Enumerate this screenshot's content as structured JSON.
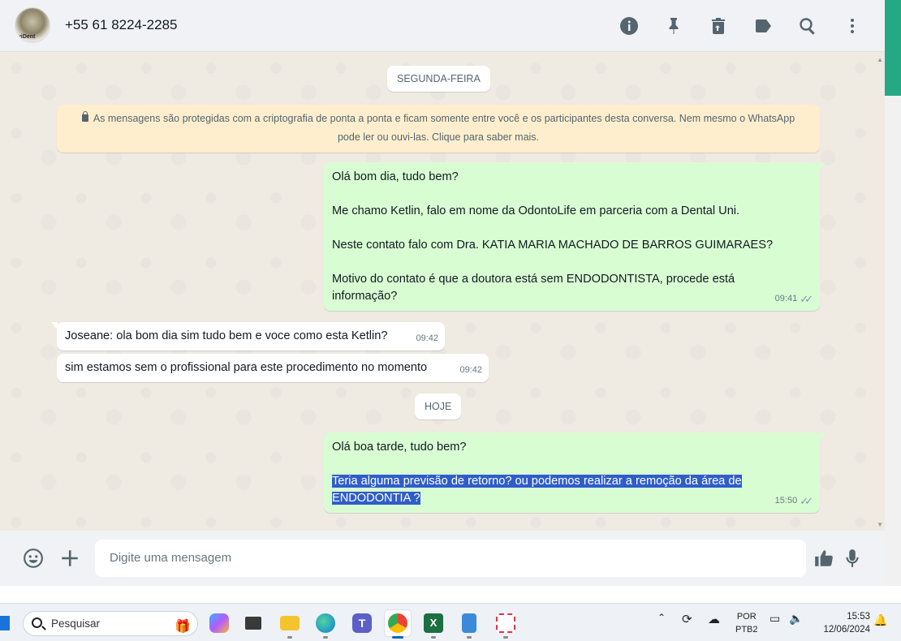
{
  "header": {
    "avatar_text": "viDent",
    "contact": "+55 61 8224-2285",
    "icons": [
      "info-icon",
      "pin-icon",
      "trash-icon",
      "label-icon",
      "search-icon",
      "menu-icon"
    ]
  },
  "chat": {
    "date1": "SEGUNDA-FEIRA",
    "notice": "As mensagens são protegidas com a criptografia de ponta a ponta e ficam somente entre você e os participantes desta conversa. Nem mesmo o WhatsApp pode ler ou ouvi-las. Clique para saber mais.",
    "msg1": {
      "lines": [
        "Olá bom dia, tudo bem?",
        "Me chamo Ketlin, falo em nome da OdontoLife em parceria com a Dental Uni.",
        "Neste contato falo com Dra. KATIA MARIA MACHADO DE BARROS GUIMARAES?",
        "Motivo do contato é que a doutora está sem ENDODONTISTA, procede está informação?"
      ],
      "time": "09:41"
    },
    "msg2": {
      "text": "Joseane:  ola bom dia sim tudo bem e voce como esta Ketlin?",
      "time": "09:42"
    },
    "msg3": {
      "text": "sim estamos sem o profissional para este procedimento no momento",
      "time": "09:42"
    },
    "date2": "HOJE",
    "msg4": {
      "line1": "Olá boa tarde, tudo bem?",
      "highlighted": "Teria alguma previsão de retorno? ou podemos realizar a remoção da área de ENDODONTIA ?",
      "time": "15:50"
    }
  },
  "composer": {
    "placeholder": "Digite uma mensagem"
  },
  "taskbar": {
    "search_placeholder": "Pesquisar",
    "lang1": "POR",
    "lang2": "PTB2",
    "time": "15:53",
    "date": "12/06/2024"
  },
  "colors": {
    "outgoing": "#d9fdd3",
    "incoming": "#ffffff",
    "notice": "#ffeecd",
    "scroll_accent": "#25a884"
  }
}
